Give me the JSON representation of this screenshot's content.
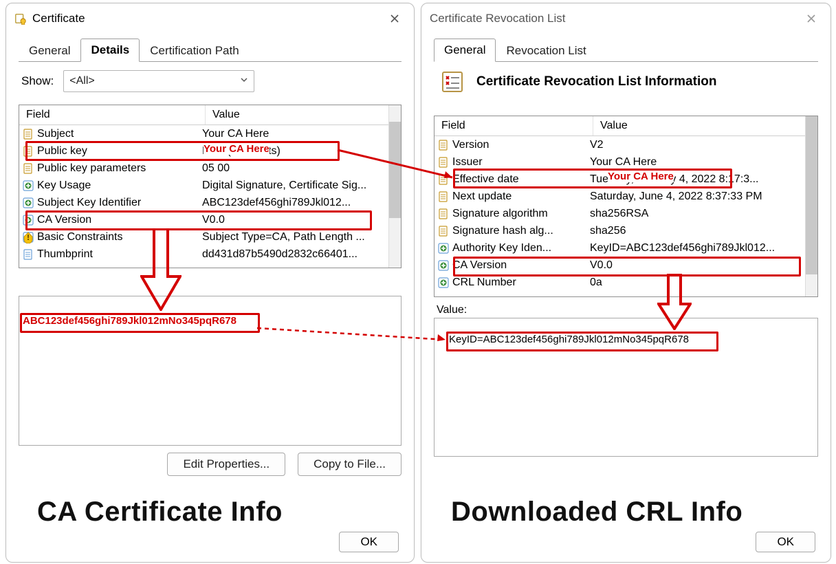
{
  "left": {
    "title": "Certificate",
    "tabs": [
      "General",
      "Details",
      "Certification Path"
    ],
    "active_tab": "Details",
    "show_label": "Show:",
    "show_value": "<All>",
    "columns": [
      "Field",
      "Value"
    ],
    "rows": [
      {
        "icon": "doc",
        "field": "Subject",
        "value": "Your CA Here"
      },
      {
        "icon": "doc",
        "field": "Public key",
        "value": "RSA (2048 Bits)"
      },
      {
        "icon": "doc",
        "field": "Public key parameters",
        "value": "05 00"
      },
      {
        "icon": "ext",
        "field": "Key Usage",
        "value": "Digital Signature, Certificate Sig..."
      },
      {
        "icon": "ext",
        "field": "Subject Key Identifier",
        "value": "ABC123def456ghi789Jkl012..."
      },
      {
        "icon": "ext",
        "field": "CA Version",
        "value": "V0.0"
      },
      {
        "icon": "crit",
        "field": "Basic Constraints",
        "value": "Subject Type=CA, Path Length ..."
      },
      {
        "icon": "page",
        "field": "Thumbprint",
        "value": "dd431d87b5490d2832c66401..."
      }
    ],
    "detail_value": "ABC123def456ghi789Jkl012mNo345pqR678",
    "btn_edit": "Edit Properties...",
    "btn_copy": "Copy to File...",
    "btn_ok": "OK",
    "caption": "CA Certificate Info"
  },
  "right": {
    "title": "Certificate Revocation List",
    "tabs": [
      "General",
      "Revocation List"
    ],
    "active_tab": "General",
    "heading": "Certificate Revocation List Information",
    "columns": [
      "Field",
      "Value"
    ],
    "rows": [
      {
        "icon": "doc",
        "field": "Version",
        "value": "V2"
      },
      {
        "icon": "doc",
        "field": "Issuer",
        "value": "Your CA Here"
      },
      {
        "icon": "doc",
        "field": "Effective date",
        "value": "Tuesday, January 4, 2022 8:17:3..."
      },
      {
        "icon": "doc",
        "field": "Next update",
        "value": "Saturday, June 4, 2022 8:37:33 PM"
      },
      {
        "icon": "doc",
        "field": "Signature algorithm",
        "value": "sha256RSA"
      },
      {
        "icon": "doc",
        "field": "Signature hash alg...",
        "value": "sha256"
      },
      {
        "icon": "ext",
        "field": "Authority Key Iden...",
        "value": "KeyID=ABC123def456ghi789Jkl012..."
      },
      {
        "icon": "ext",
        "field": "CA Version",
        "value": "V0.0"
      },
      {
        "icon": "ext",
        "field": "CRL Number",
        "value": "0a"
      }
    ],
    "value_label": "Value:",
    "detail_value": "KeyID=ABC123def456ghi789Jkl012mNo345pqR678",
    "btn_ok": "OK",
    "caption": "Downloaded CRL Info"
  },
  "annotation_color": "#d40000"
}
